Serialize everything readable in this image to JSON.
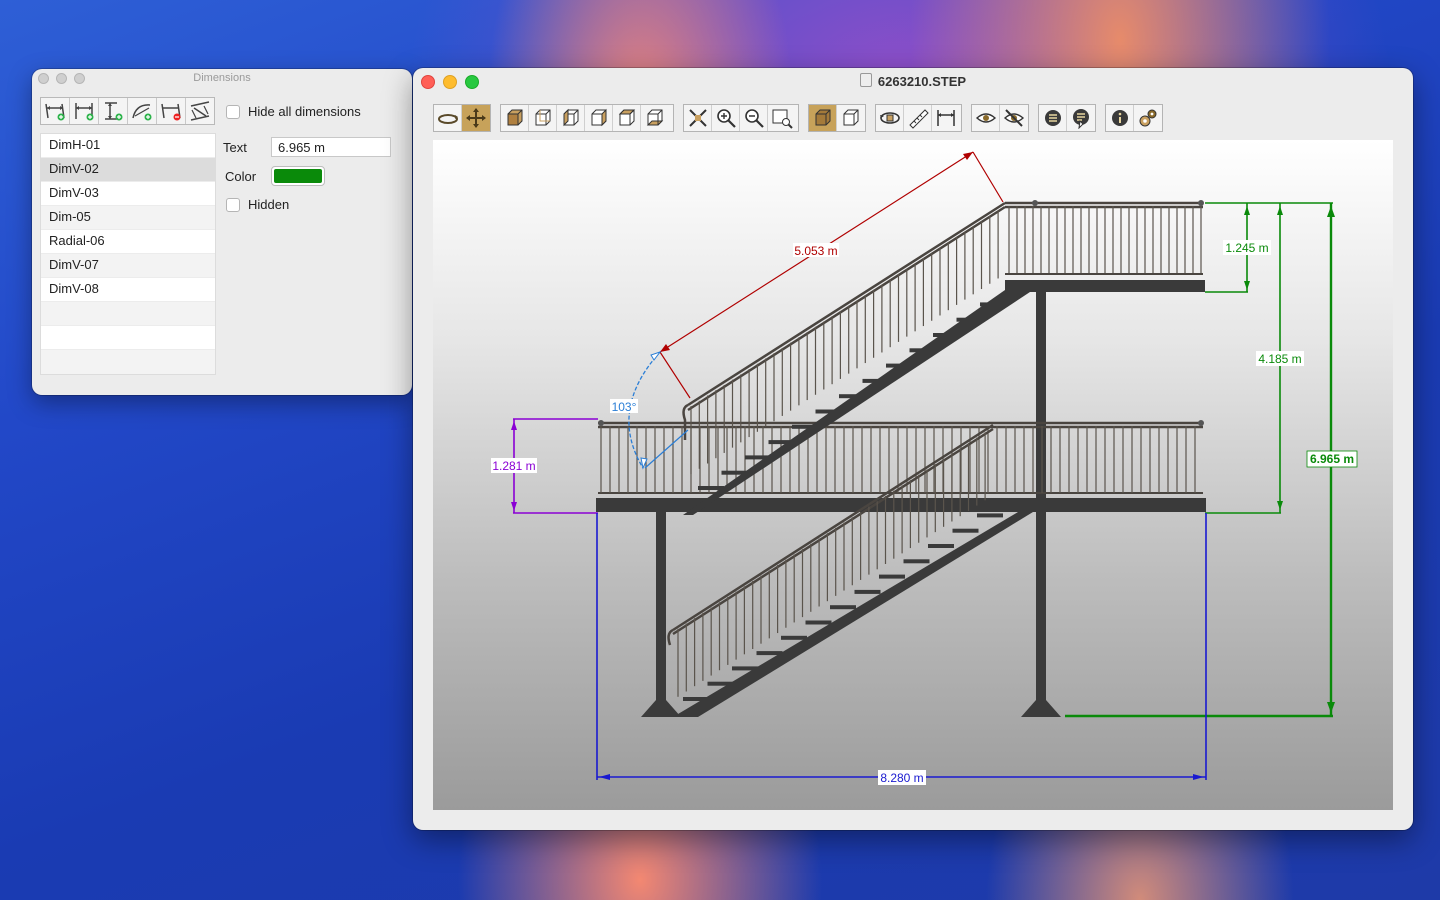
{
  "dimensions_panel": {
    "title": "Dimensions",
    "toolbar_icons": [
      "add-horizontal-dimension-icon",
      "add-vertical-length-dimension-icon",
      "add-vertical-dimension-icon",
      "add-radial-dimension-icon",
      "delete-dimension-icon",
      "aligned-dimension-icon"
    ],
    "hide_all_label": "Hide all dimensions",
    "hide_all_checked": false,
    "items": [
      {
        "label": "DimH-01",
        "selected": false
      },
      {
        "label": "DimV-02",
        "selected": true
      },
      {
        "label": "DimV-03",
        "selected": false
      },
      {
        "label": "Dim-05",
        "selected": false
      },
      {
        "label": "Radial-06",
        "selected": false
      },
      {
        "label": "DimV-07",
        "selected": false
      },
      {
        "label": "DimV-08",
        "selected": false
      }
    ],
    "props": {
      "text_label": "Text",
      "text_value": "6.965 m",
      "color_label": "Color",
      "color_value": "#0a8a0a",
      "hidden_label": "Hidden",
      "hidden_checked": false
    }
  },
  "main_window": {
    "title": "6263210.STEP",
    "toolbar_groups": [
      [
        "orbit-icon",
        "pan-icon"
      ],
      [
        "view-front-icon",
        "view-back-icon",
        "view-left-icon",
        "view-right-icon",
        "view-top-icon",
        "view-bottom-icon"
      ],
      [
        "zoom-fit-icon",
        "zoom-in-icon",
        "zoom-out-icon",
        "zoom-window-icon"
      ],
      [
        "shaded-mode-icon",
        "wireframe-mode-icon"
      ],
      [
        "rotate-model-icon",
        "measure-icon",
        "dimension-icon"
      ],
      [
        "visibility-icon",
        "hide-icon"
      ],
      [
        "layers-icon",
        "annotations-icon"
      ],
      [
        "info-icon",
        "settings-icon"
      ]
    ],
    "active_tools": [
      "pan-icon",
      "shaded-mode-icon"
    ],
    "dimensions": {
      "aligned": "5.053 m",
      "angle": "103°",
      "left_vertical": "1.281 m",
      "top_right": "1.245 m",
      "middle_right": "4.185 m",
      "overall_right": "6.965 m",
      "bottom": "8.280 m"
    },
    "colors": {
      "red": "#b00000",
      "blue_angle": "#2a7ed6",
      "purple": "#8a00d4",
      "green": "#0a8a0a",
      "blue": "#1a1ad0"
    }
  }
}
